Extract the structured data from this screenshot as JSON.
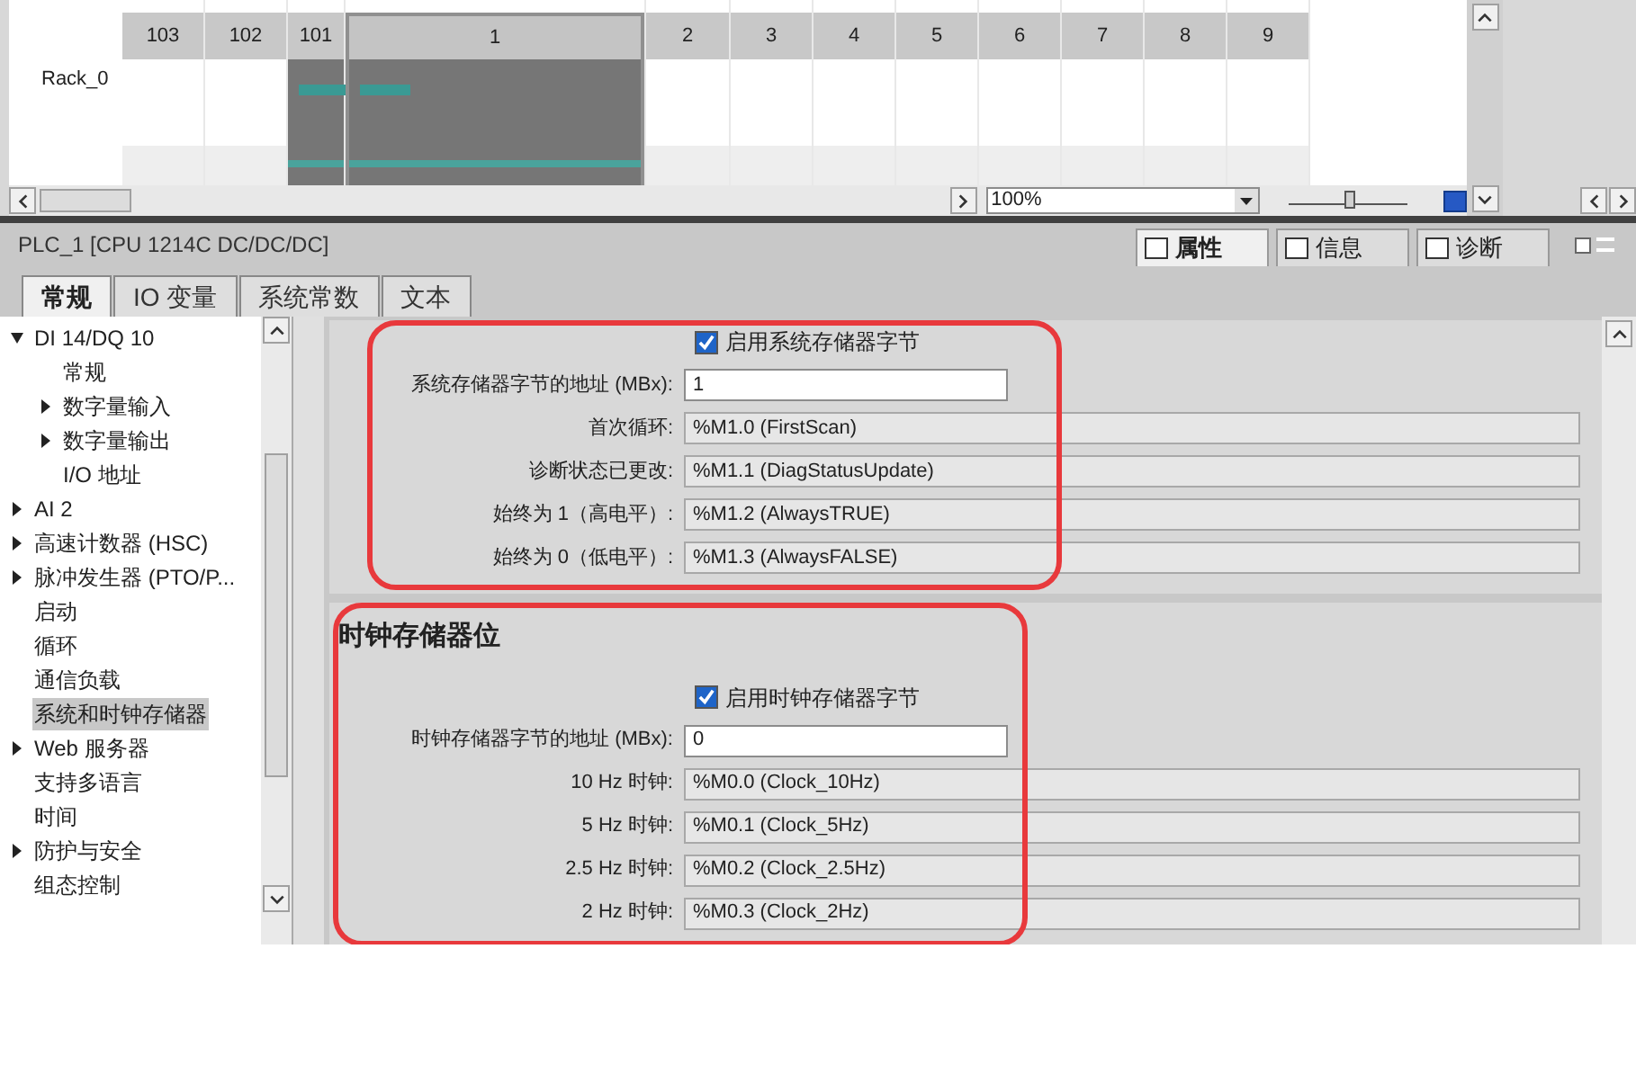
{
  "rack": {
    "name": "Rack_0",
    "slots": [
      {
        "label": "103",
        "selected": false,
        "module": false
      },
      {
        "label": "102",
        "selected": false,
        "module": false
      },
      {
        "label": "101",
        "selected": false,
        "module": true
      },
      {
        "label": "1",
        "selected": true,
        "module": true
      },
      {
        "label": "2",
        "selected": false,
        "module": false
      },
      {
        "label": "3",
        "selected": false,
        "module": false
      },
      {
        "label": "4",
        "selected": false,
        "module": false
      },
      {
        "label": "5",
        "selected": false,
        "module": false
      },
      {
        "label": "6",
        "selected": false,
        "module": false
      },
      {
        "label": "7",
        "selected": false,
        "module": false
      },
      {
        "label": "8",
        "selected": false,
        "module": false
      },
      {
        "label": "9",
        "selected": false,
        "module": false
      }
    ],
    "zoom": "100%",
    "zoom_slider": {
      "level": 0.5
    }
  },
  "inspector": {
    "title": "PLC_1 [CPU 1214C DC/DC/DC]",
    "view_tabs": [
      {
        "label": "属性",
        "selected": true
      },
      {
        "label": "信息",
        "selected": false
      },
      {
        "label": "诊断",
        "selected": false
      }
    ],
    "tabs": [
      {
        "label": "常规",
        "selected": true
      },
      {
        "label": "IO 变量",
        "selected": false
      },
      {
        "label": "系统常数",
        "selected": false
      },
      {
        "label": "文本",
        "selected": false
      }
    ]
  },
  "tree": [
    {
      "label": "DI 14/DQ 10",
      "kind": "group",
      "expanded": true,
      "selected": false,
      "children": [
        {
          "label": "常规",
          "kind": "leaf",
          "selected": false
        },
        {
          "label": "数字量输入",
          "kind": "group",
          "expanded": false,
          "selected": false
        },
        {
          "label": "数字量输出",
          "kind": "group",
          "expanded": false,
          "selected": false
        },
        {
          "label": "I/O 地址",
          "kind": "leaf",
          "selected": false
        }
      ]
    },
    {
      "label": "AI 2",
      "kind": "group",
      "expanded": false,
      "selected": false
    },
    {
      "label": "高速计数器 (HSC)",
      "kind": "group",
      "expanded": false,
      "selected": false
    },
    {
      "label": "脉冲发生器 (PTO/P...",
      "kind": "group",
      "expanded": false,
      "selected": false
    },
    {
      "label": "启动",
      "kind": "leaf",
      "selected": false
    },
    {
      "label": "循环",
      "kind": "leaf",
      "selected": false
    },
    {
      "label": "通信负载",
      "kind": "leaf",
      "selected": false
    },
    {
      "label": "系统和时钟存储器",
      "kind": "leaf",
      "selected": true
    },
    {
      "label": "Web 服务器",
      "kind": "group",
      "expanded": false,
      "selected": false
    },
    {
      "label": "支持多语言",
      "kind": "leaf",
      "selected": false
    },
    {
      "label": "时间",
      "kind": "leaf",
      "selected": false
    },
    {
      "label": "防护与安全",
      "kind": "group",
      "expanded": false,
      "selected": false
    },
    {
      "label": "组态控制",
      "kind": "leaf",
      "selected": false
    }
  ],
  "sections": [
    {
      "highlighted": true,
      "checkbox": {
        "label": "启用系统存储器字节",
        "checked": true
      },
      "fields": [
        {
          "label": "系统存储器字节的地址 (MBx):",
          "value": "1",
          "kind": "input"
        },
        {
          "label": "首次循环:",
          "value": "%M1.0 (FirstScan)",
          "kind": "readonly"
        },
        {
          "label": "诊断状态已更改:",
          "value": "%M1.1 (DiagStatusUpdate)",
          "kind": "readonly"
        },
        {
          "label": "始终为 1（高电平）:",
          "value": "%M1.2 (AlwaysTRUE)",
          "kind": "readonly"
        },
        {
          "label": "始终为 0（低电平）:",
          "value": "%M1.3 (AlwaysFALSE)",
          "kind": "readonly"
        }
      ]
    },
    {
      "title": "时钟存储器位",
      "highlighted": true,
      "checkbox": {
        "label": "启用时钟存储器字节",
        "checked": true
      },
      "fields": [
        {
          "label": "时钟存储器字节的地址 (MBx):",
          "value": "0",
          "kind": "input"
        },
        {
          "label": "10 Hz 时钟:",
          "value": "%M0.0 (Clock_10Hz)",
          "kind": "readonly"
        },
        {
          "label": "5 Hz 时钟:",
          "value": "%M0.1 (Clock_5Hz)",
          "kind": "readonly"
        },
        {
          "label": "2.5 Hz 时钟:",
          "value": "%M0.2 (Clock_2.5Hz)",
          "kind": "readonly"
        },
        {
          "label": "2 Hz 时钟:",
          "value": "%M0.3 (Clock_2Hz)",
          "kind": "readonly"
        }
      ]
    }
  ]
}
